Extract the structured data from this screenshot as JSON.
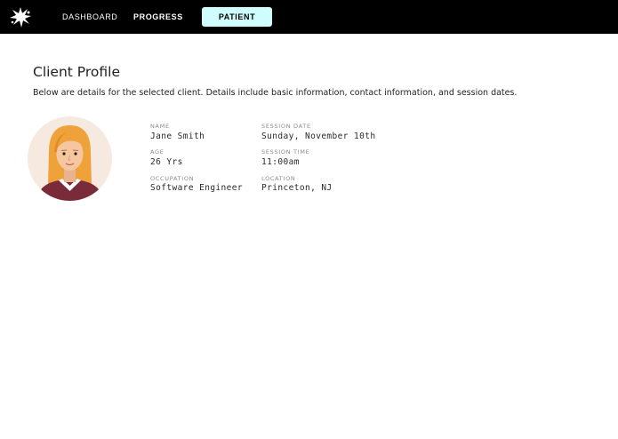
{
  "nav": {
    "logo_icon": "splat-logo-icon",
    "items": [
      {
        "label": "DASHBOARD",
        "active": false
      },
      {
        "label": "PROGRESS",
        "active": false
      },
      {
        "label": "PATIENT",
        "active": true
      }
    ],
    "active_color": "#cffcfd"
  },
  "profile": {
    "title": "Client Profile",
    "description": "Below are details for the selected client. Details include basic information, contact information, and session dates.",
    "avatar_icon": "female-avatar-icon",
    "fields": {
      "name": {
        "label": "NAME",
        "value": "Jane Smith"
      },
      "age": {
        "label": "AGE",
        "value": "26 Yrs"
      },
      "occupation": {
        "label": "OCCUPATION",
        "value": "Software Engineer"
      },
      "session_date": {
        "label": "SESSION DATE",
        "value": "Sunday, November 10th"
      },
      "session_time": {
        "label": "SESSION TIME",
        "value": "11:00am"
      },
      "location": {
        "label": "LOCATION",
        "value": "Princeton, NJ"
      }
    }
  }
}
